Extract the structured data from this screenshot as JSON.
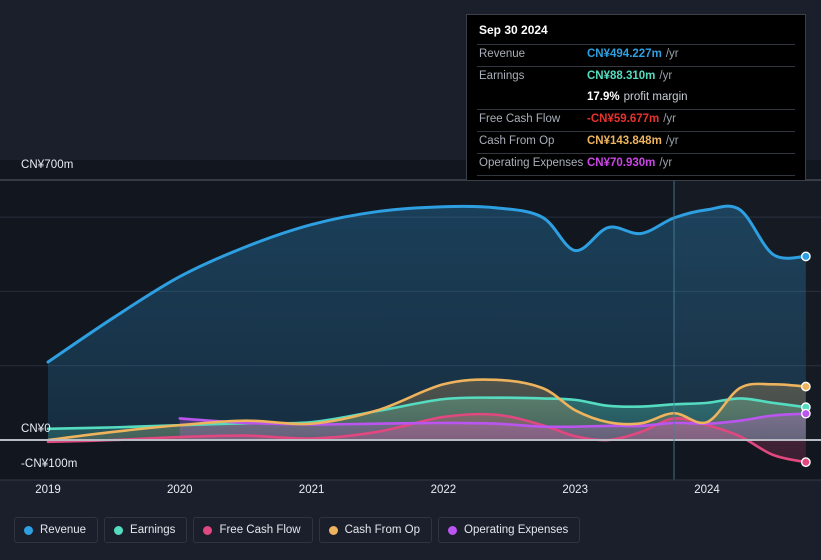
{
  "chart_data": {
    "type": "area",
    "title": "",
    "xlabel": "",
    "ylabel": "",
    "currency": "CN¥",
    "ylim": [
      -100,
      700
    ],
    "y_ticks": [
      {
        "label": "CN¥700m",
        "value": 700
      },
      {
        "label": "CN¥0",
        "value": 0
      },
      {
        "label": "-CN¥100m",
        "value": -100
      }
    ],
    "gridlines": [
      700,
      600,
      400,
      200,
      0
    ],
    "grid": true,
    "legend_position": "bottom",
    "x_ticks": [
      "2019",
      "2020",
      "2021",
      "2022",
      "2023",
      "2024"
    ],
    "x": [
      2019.0,
      2019.5,
      2020.0,
      2020.5,
      2021.0,
      2021.5,
      2022.0,
      2022.4,
      2022.75,
      2023.0,
      2023.25,
      2023.5,
      2023.75,
      2024.0,
      2024.25,
      2024.5,
      2024.75
    ],
    "series": [
      {
        "name": "Revenue",
        "color": "#2e9fe0",
        "values": [
          210,
          330,
          440,
          520,
          580,
          615,
          628,
          625,
          600,
          510,
          572,
          556,
          598,
          620,
          620,
          500,
          494.227
        ]
      },
      {
        "name": "Earnings",
        "color": "#55dcc0",
        "values": [
          30,
          34,
          40,
          45,
          48,
          78,
          110,
          114,
          112,
          108,
          92,
          90,
          96,
          100,
          112,
          100,
          88.31
        ]
      },
      {
        "name": "Free Cash Flow",
        "color": "#e0487f",
        "values": [
          -5,
          0,
          8,
          12,
          4,
          22,
          62,
          68,
          40,
          10,
          0,
          22,
          58,
          40,
          10,
          -40,
          -59.677
        ]
      },
      {
        "name": "Cash From Op",
        "color": "#edb35d",
        "values": [
          0,
          22,
          40,
          52,
          44,
          80,
          150,
          162,
          140,
          80,
          48,
          45,
          72,
          48,
          140,
          150,
          143.848
        ]
      },
      {
        "name": "Operating Expenses",
        "color": "#bb55f0",
        "values": [
          null,
          null,
          58,
          46,
          42,
          44,
          46,
          44,
          36,
          36,
          38,
          38,
          46,
          44,
          52,
          66,
          70.93
        ]
      }
    ]
  },
  "tooltip": {
    "date": "Sep 30 2024",
    "rows": [
      {
        "label": "Revenue",
        "value": "CN¥494.227m",
        "color": "#2e9fe0",
        "unit": "/yr"
      },
      {
        "label": "Earnings",
        "value": "CN¥88.310m",
        "color": "#55dcc0",
        "unit": "/yr"
      },
      {
        "label": "",
        "value": "17.9%",
        "color": "#ffffff",
        "suffix": "profit margin"
      },
      {
        "label": "Free Cash Flow",
        "value": "-CN¥59.677m",
        "color": "#e8322e",
        "unit": "/yr"
      },
      {
        "label": "Cash From Op",
        "value": "CN¥143.848m",
        "color": "#edb35d",
        "unit": "/yr"
      },
      {
        "label": "Operating Expenses",
        "value": "CN¥70.930m",
        "color": "#cc45e8",
        "unit": "/yr"
      }
    ]
  },
  "legend": {
    "items": [
      {
        "label": "Revenue",
        "color": "#2e9fe0"
      },
      {
        "label": "Earnings",
        "color": "#55dcc0"
      },
      {
        "label": "Free Cash Flow",
        "color": "#e0487f"
      },
      {
        "label": "Cash From Op",
        "color": "#edb35d"
      },
      {
        "label": "Operating Expenses",
        "color": "#bb55f0"
      }
    ]
  },
  "axes": {
    "y_top": "CN¥700m",
    "y_zero": "CN¥0",
    "y_neg": "-CN¥100m",
    "x_labels": [
      "2019",
      "2020",
      "2021",
      "2022",
      "2023",
      "2024"
    ]
  }
}
